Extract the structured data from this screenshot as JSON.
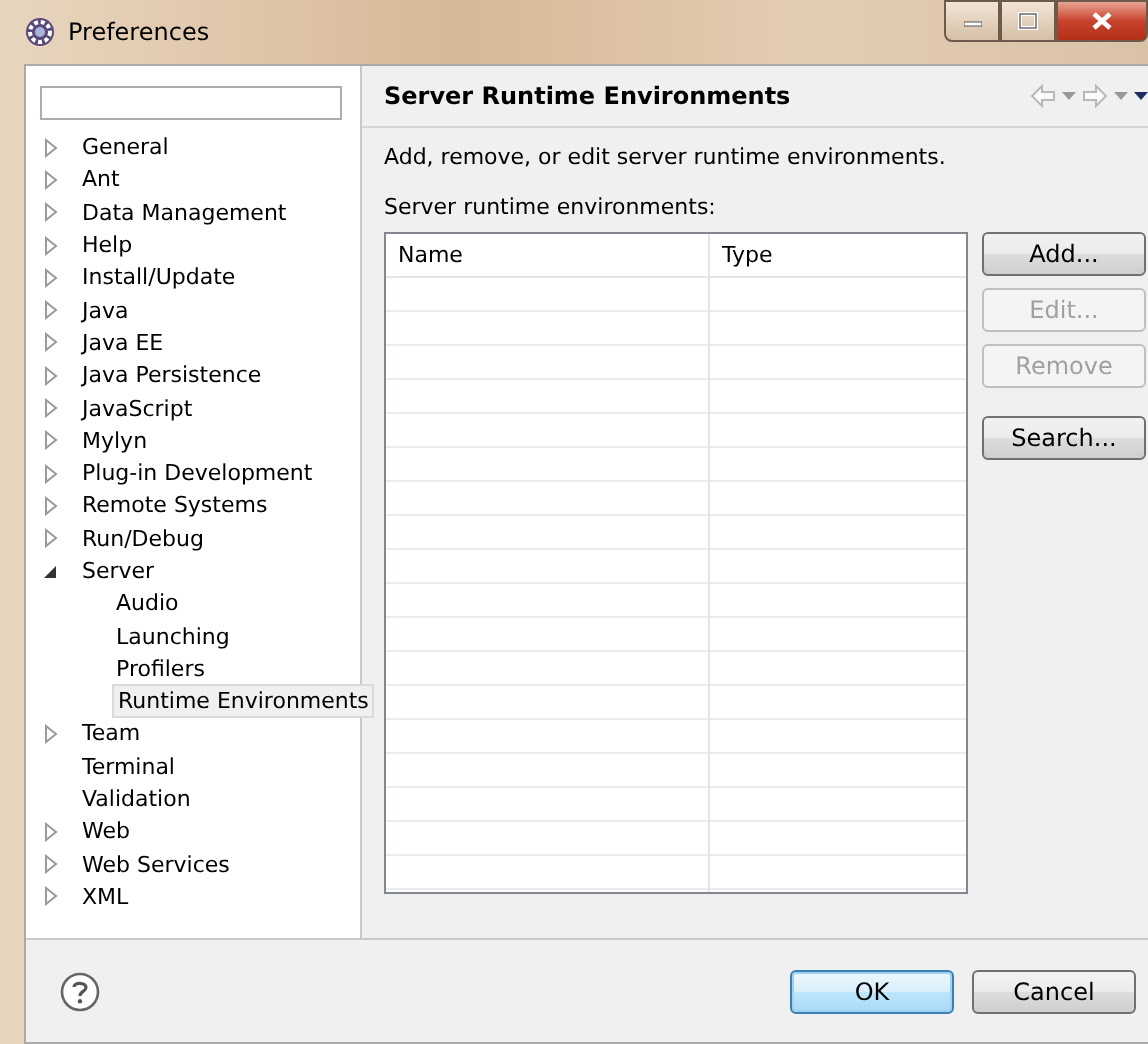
{
  "window": {
    "title": "Preferences"
  },
  "tree": [
    {
      "label": "General",
      "kind": "branch",
      "expanded": false,
      "selected": false
    },
    {
      "label": "Ant",
      "kind": "branch",
      "expanded": false,
      "selected": false
    },
    {
      "label": "Data Management",
      "kind": "branch",
      "expanded": false,
      "selected": false
    },
    {
      "label": "Help",
      "kind": "branch",
      "expanded": false,
      "selected": false
    },
    {
      "label": "Install/Update",
      "kind": "branch",
      "expanded": false,
      "selected": false
    },
    {
      "label": "Java",
      "kind": "branch",
      "expanded": false,
      "selected": false
    },
    {
      "label": "Java EE",
      "kind": "branch",
      "expanded": false,
      "selected": false
    },
    {
      "label": "Java Persistence",
      "kind": "branch",
      "expanded": false,
      "selected": false
    },
    {
      "label": "JavaScript",
      "kind": "branch",
      "expanded": false,
      "selected": false
    },
    {
      "label": "Mylyn",
      "kind": "branch",
      "expanded": false,
      "selected": false
    },
    {
      "label": "Plug-in Development",
      "kind": "branch",
      "expanded": false,
      "selected": false
    },
    {
      "label": "Remote Systems",
      "kind": "branch",
      "expanded": false,
      "selected": false
    },
    {
      "label": "Run/Debug",
      "kind": "branch",
      "expanded": false,
      "selected": false
    },
    {
      "label": "Server",
      "kind": "branch",
      "expanded": true,
      "selected": false,
      "children": [
        {
          "label": "Audio",
          "selected": false
        },
        {
          "label": "Launching",
          "selected": false
        },
        {
          "label": "Profilers",
          "selected": false
        },
        {
          "label": "Runtime Environments",
          "selected": true
        }
      ]
    },
    {
      "label": "Team",
      "kind": "branch",
      "expanded": false,
      "selected": false
    },
    {
      "label": "Terminal",
      "kind": "leaf",
      "selected": false
    },
    {
      "label": "Validation",
      "kind": "leaf",
      "selected": false
    },
    {
      "label": "Web",
      "kind": "branch",
      "expanded": false,
      "selected": false
    },
    {
      "label": "Web Services",
      "kind": "branch",
      "expanded": false,
      "selected": false
    },
    {
      "label": "XML",
      "kind": "branch",
      "expanded": false,
      "selected": false
    }
  ],
  "page": {
    "title": "Server Runtime Environments",
    "description": "Add, remove, or edit server runtime environments.",
    "list_label": "Server runtime environments:"
  },
  "table": {
    "columns": [
      "Name",
      "Type"
    ]
  },
  "side_buttons": [
    {
      "label": "Add...",
      "disabled": false
    },
    {
      "label": "Edit...",
      "disabled": true
    },
    {
      "label": "Remove",
      "disabled": true
    },
    {
      "label": "Search...",
      "disabled": false
    }
  ],
  "buttons": [
    {
      "label": "OK",
      "default": true
    },
    {
      "label": "Cancel",
      "default": false
    }
  ]
}
